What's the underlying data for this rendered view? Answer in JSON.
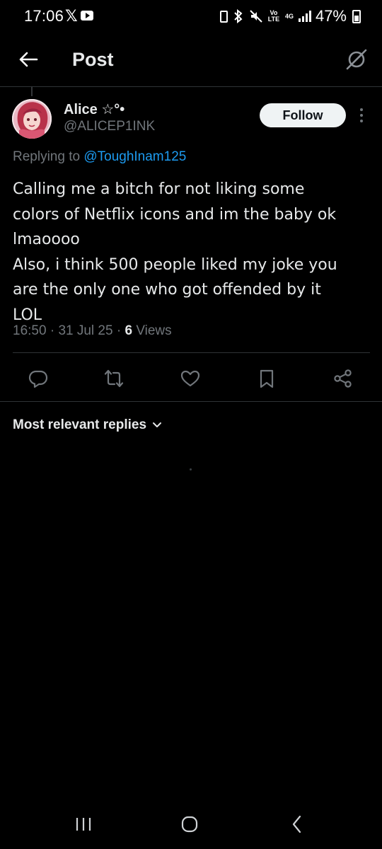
{
  "status_bar": {
    "time": "17:06",
    "x_glyph": "𝕏",
    "youtube_icon": "youtube-icon",
    "network_volte": "Vo LTE",
    "network_type": "4G",
    "battery_percent": "47%"
  },
  "header": {
    "title": "Post",
    "back_icon": "arrow-left-icon",
    "grok_icon": "grok-icon"
  },
  "post": {
    "author": {
      "name": "Alice ☆°•",
      "handle": "@ALICEP1INK"
    },
    "follow_label": "Follow",
    "replying_prefix": "Replying to ",
    "replying_to": "@ToughInam125",
    "text_lines": [
      "Calling me a bitch for not liking some",
      "colors of Netflix icons and im the baby ok",
      "lmaoooo",
      "Also, i think 500 people liked my joke you",
      "are the only one who got offended by it",
      "LOL"
    ],
    "time": "16:50",
    "date": "31 Jul 25",
    "separator": "·",
    "views_count": "6",
    "views_label": "Views"
  },
  "actions": {
    "reply": "reply-icon",
    "repost": "repost-icon",
    "like": "heart-icon",
    "bookmark": "bookmark-icon",
    "share": "share-icon"
  },
  "replies": {
    "filter_label": "Most relevant replies"
  },
  "colors": {
    "background": "#000000",
    "text": "#e7e9ea",
    "muted": "#71767b",
    "accent": "#1d9bf0",
    "divider": "#2f3336"
  }
}
